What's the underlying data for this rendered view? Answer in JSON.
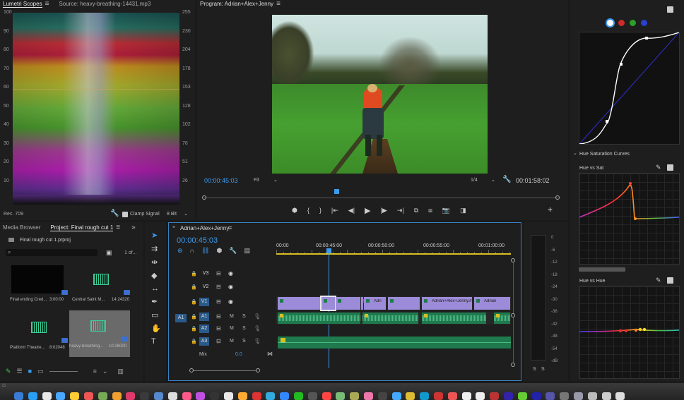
{
  "scopes": {
    "tabs": [
      "Lumetri Scopes",
      "Source: heavy-breathing-14431.mp3"
    ],
    "left_scale": [
      "100",
      "90",
      "80",
      "70",
      "60",
      "50",
      "40",
      "30",
      "20",
      "10"
    ],
    "right_scale": [
      "255",
      "230",
      "204",
      "178",
      "153",
      "128",
      "102",
      "76",
      "51",
      "26"
    ],
    "color_space": "Rec. 709",
    "clamp_signal": "Clamp Signal",
    "bit_depth": "8 Bit"
  },
  "program": {
    "title": "Program: Adrian+Alex+Jenny",
    "timecode": "00:00:45:03",
    "fit": "Fit",
    "quality": "1/4",
    "duration": "00:01:58:02"
  },
  "lumetri": {
    "hue_sat_curves": "Hue Saturation Curves",
    "hue_vs_sat": "Hue vs Sat",
    "hue_vs_hue": "Hue vs Hue",
    "channel_colors": [
      "#ffffff",
      "#d02a2a",
      "#2aa02a",
      "#2a40d0"
    ]
  },
  "project": {
    "tabs": [
      "Media Browser",
      "Project: Final rough cut 1"
    ],
    "file": "Final rough cut 1.prproj",
    "page": "1 of...",
    "items": [
      {
        "name": "Final ending Cred...",
        "duration": "3:00:00"
      },
      {
        "name": "Central Saint M...",
        "duration": "14:24320"
      },
      {
        "name": "Platform Theatre...",
        "duration": "8:02048"
      },
      {
        "name": "heavy-breathing...",
        "duration": "10:26000"
      }
    ]
  },
  "timeline": {
    "title": "Adrian+Alex+Jenny",
    "timecode": "00:00:45:03",
    "ruler": [
      "00:00",
      "00:00:45:00",
      "00:00:50:00",
      "00:00:55:00",
      "00:01:00:00"
    ],
    "tracks": [
      {
        "name": "V3"
      },
      {
        "name": "V2"
      },
      {
        "name": "V1"
      },
      {
        "name": "A1"
      },
      {
        "name": "A2"
      },
      {
        "name": "A3"
      }
    ],
    "source_patch": "A1",
    "track_m": "M",
    "track_s": "S",
    "mix_label": "Mix",
    "mix_value": "0.0",
    "clip_labels": [
      "Adri",
      "Adrian+Alex+Jenny.m",
      "Adrian"
    ]
  },
  "meter": {
    "scale": [
      "0",
      "-6",
      "-12",
      "-18",
      "-24",
      "-30",
      "-36",
      "-42",
      "-48",
      "-54",
      "-dB"
    ],
    "solo": [
      "S",
      "S"
    ]
  }
}
